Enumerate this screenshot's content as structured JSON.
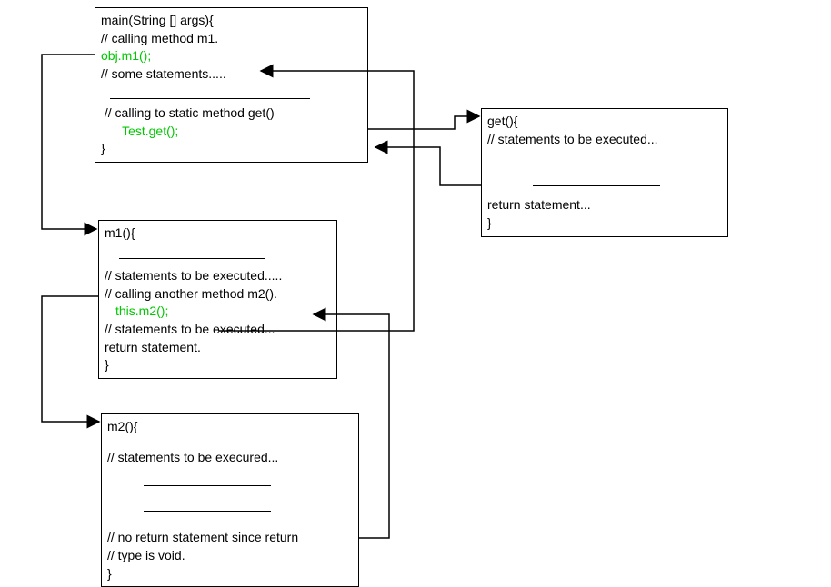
{
  "boxes": {
    "main": {
      "lines": {
        "l1": "main(String [] args){",
        "l2": "// calling method m1.",
        "l3": "obj.m1();",
        "l4": "// some statements.....",
        "l5": " // calling to static method get()",
        "l6": "      Test.get();",
        "l7": "}"
      }
    },
    "get": {
      "lines": {
        "l1": "get(){",
        "l2": "// statements to be executed...",
        "l3": "return statement...",
        "l4": "}"
      }
    },
    "m1": {
      "lines": {
        "l1": "m1(){",
        "l2": "// statements to be executed.....",
        "l3": "// calling another method m2().",
        "l4": "this.m2();",
        "l5": "// statements to be executed...",
        "l6": "return statement.",
        "l7": "}"
      }
    },
    "m2": {
      "lines": {
        "l1": "m2(){",
        "l2": "// statements to be execured...",
        "l3": "// no return statement since return",
        "l4": "// type is void.",
        "l5": "}"
      }
    }
  }
}
